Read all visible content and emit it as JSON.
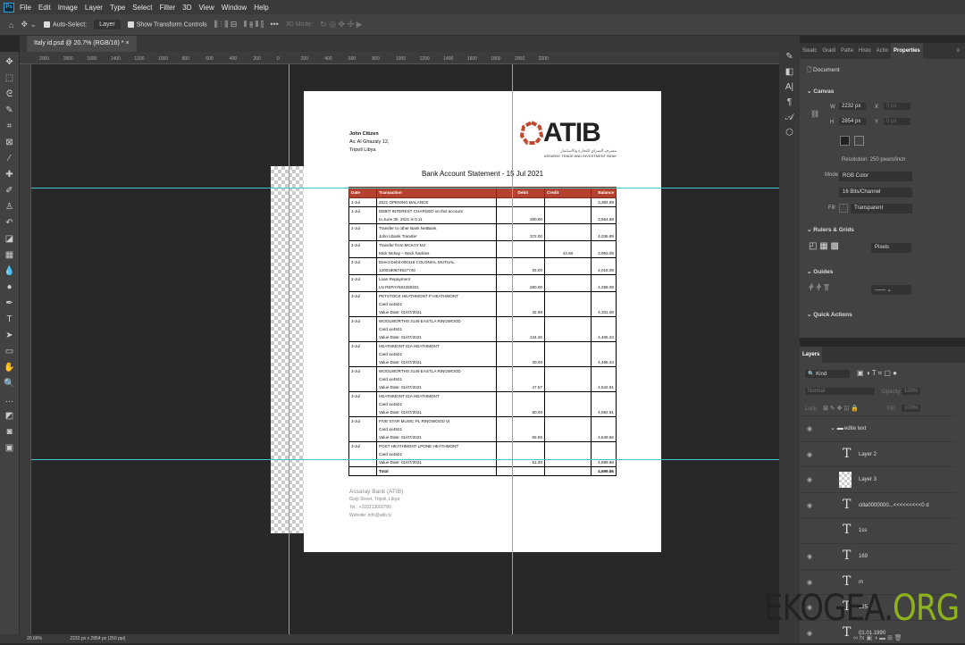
{
  "app": {
    "menu": [
      "File",
      "Edit",
      "Image",
      "Layer",
      "Type",
      "Select",
      "Filter",
      "3D",
      "View",
      "Window",
      "Help"
    ],
    "options": {
      "auto_select": "Auto-Select:",
      "layer_select": "Layer",
      "show_transform": "Show Transform Controls",
      "mode_3d": "3D Mode:"
    },
    "doc_tab": "Italy id.psd @ 20.7% (RGB/16) *",
    "ruler_labels": [
      "2000",
      "1800",
      "1600",
      "1400",
      "1200",
      "1000",
      "800",
      "600",
      "400",
      "200",
      "0",
      "200",
      "400",
      "600",
      "800",
      "1000",
      "1200",
      "1400",
      "1600",
      "1800",
      "2000",
      "2200"
    ],
    "status": {
      "zoom": "20.66%",
      "size": "2232 px x 2854 px (250 ppi)"
    }
  },
  "statement": {
    "name": "John Citizen",
    "addr1": "Av. Al Ghazaly 12,",
    "addr2": "Tripoli Libya",
    "logo": "ATIB",
    "logo_sub": "ASSARAY TRADE AND INVESTMENT BANK",
    "logo_ar": "مصرف السراي للتجارة والاستثمار",
    "title": "Bank Account Statement - 15 Jul 2021",
    "headers": [
      "Date",
      "Transaction",
      "Debit",
      "Credit",
      "Balance"
    ],
    "rows": [
      {
        "date": "1-Jul",
        "lines": [
          "2021 OPENING BALANCE"
        ],
        "debit": "",
        "credit": "",
        "balance": "3,384.89"
      },
      {
        "date": "1-Jul",
        "lines": [
          "DEBIT INTEREST CHARGED on this account",
          "to June 30, 2021 is 0.11"
        ],
        "debit": "280.00",
        "credit": "",
        "balance": "3,664.89"
      },
      {
        "date": "2-Jul",
        "lines": [
          "Transfer to other Bank NetBank",
          "John Ubank Transfer"
        ],
        "debit": "372.00",
        "credit": "",
        "balance": "4,036.89"
      },
      {
        "date": "2-Jul",
        "lines": [
          "Transfer from MCKAY MJ",
          "Mick Mckay – Neck hackles"
        ],
        "debit": "",
        "credit": "43.80",
        "balance": "3,993.09"
      },
      {
        "date": "2-Jul",
        "lines": [
          "Direct Debit 000116 COLONIAL MUTUAL",
          "1200180874627740"
        ],
        "debit": "25.00",
        "credit": "",
        "balance": "4,018.09"
      },
      {
        "date": "2-Jul",
        "lines": [
          "Loan Repayment",
          "LN REPAY604259331"
        ],
        "debit": "280.00",
        "credit": "",
        "balance": "4,298.09"
      },
      {
        "date": "3-Jul",
        "lines": [
          "PETSTOCK HEATHMONT P HEATHMONT",
          "Card xx4521",
          "Value Date: 01/07/2021"
        ],
        "debit": "32.99",
        "credit": "",
        "balance": "4,331.08"
      },
      {
        "date": "3-Jul",
        "lines": [
          "WOOLWORTHS 3149 EASTLA RINGWOOD",
          "Card xx4521",
          "Value Date: 01/07/2021"
        ],
        "debit": "134.26",
        "credit": "",
        "balance": "4,465.34"
      },
      {
        "date": "3-Jul",
        "lines": [
          "HEATHMONT IGA HEATHMONT",
          "Card xx4521",
          "Value Date: 01/07/2021"
        ],
        "debit": "30.00",
        "credit": "",
        "balance": "4,495.34"
      },
      {
        "date": "3-Jul",
        "lines": [
          "WOOLWORTHS 3149 EASTLA RINGWOOD",
          "Card xx4521",
          "Value Date: 01/07/2021"
        ],
        "debit": "47.57",
        "credit": "",
        "balance": "4,542.91"
      },
      {
        "date": "3-Jul",
        "lines": [
          "HEATHMONT IGA HEATHMONT",
          "Card xx4521",
          "Value Date: 01/07/2021"
        ],
        "debit": "50.00",
        "credit": "",
        "balance": "4,592.91"
      },
      {
        "date": "3-Jul",
        "lines": [
          "FIVE STAR MUSIC PL RINGWOOD VI",
          "Card xx4521",
          "Value Date: 01/07/2021"
        ],
        "debit": "55.65",
        "credit": "",
        "balance": "4,648.56"
      },
      {
        "date": "3-Jul",
        "lines": [
          "POST HEATHMONT LPONE HEATHMONT",
          "Card xx4521",
          "Value Date: 01/07/2021"
        ],
        "debit": "51.30",
        "credit": "",
        "balance": "4,699.86"
      }
    ],
    "total_label": "Total",
    "total": "4,699.86",
    "footer": [
      "Assaray Bank (ATIB)",
      "Gurji Street, Tripoli, Libya",
      "Tel.: +218213660780",
      "Website: info@atib.ly"
    ]
  },
  "properties": {
    "tabs": [
      "Swatc",
      "Gradi",
      "Patte",
      "Histo",
      "Actio",
      "Properties"
    ],
    "doc_label": "Document",
    "canvas": "Canvas",
    "w_label": "W",
    "w": "2232 px",
    "h_label": "H",
    "h": "2854 px",
    "x_label": "X",
    "x": "0 px",
    "y_label": "Y",
    "y": "0 px",
    "resolution": "Resolution: 250 pixels/inch",
    "mode_label": "Mode",
    "mode": "RGB Color",
    "depth": "16 Bits/Channel",
    "fill_label": "Fill",
    "fill": "Transparent",
    "rulers": "Rulers & Grids",
    "units": "Pixels",
    "guides": "Guides",
    "quick": "Quick Actions"
  },
  "layers": {
    "tab": "Layers",
    "kind": "Kind",
    "blend": "Normal",
    "opacity_label": "Opacity:",
    "opacity": "100%",
    "lock_label": "Lock:",
    "fill_label": "Fill:",
    "fill": "100%",
    "items": [
      {
        "name": "edite text",
        "type": "group"
      },
      {
        "name": "Layer 2",
        "type": "text"
      },
      {
        "name": "Layer 3",
        "type": "image"
      },
      {
        "name": "cilla0000000...<<<<<<<<<0 d",
        "type": "text"
      },
      {
        "name": "1ss",
        "type": "text"
      },
      {
        "name": "169",
        "type": "text"
      },
      {
        "name": "m",
        "type": "text"
      },
      {
        "name": "125...",
        "type": "text"
      },
      {
        "name": "01.01.1990",
        "type": "text"
      }
    ]
  },
  "watermark": {
    "a": "EKOGEA.",
    "b": "ORG"
  },
  "colors": {
    "accent": "#b5412f",
    "guide": "#3cc7d0",
    "wm_green": "#8db31c"
  }
}
